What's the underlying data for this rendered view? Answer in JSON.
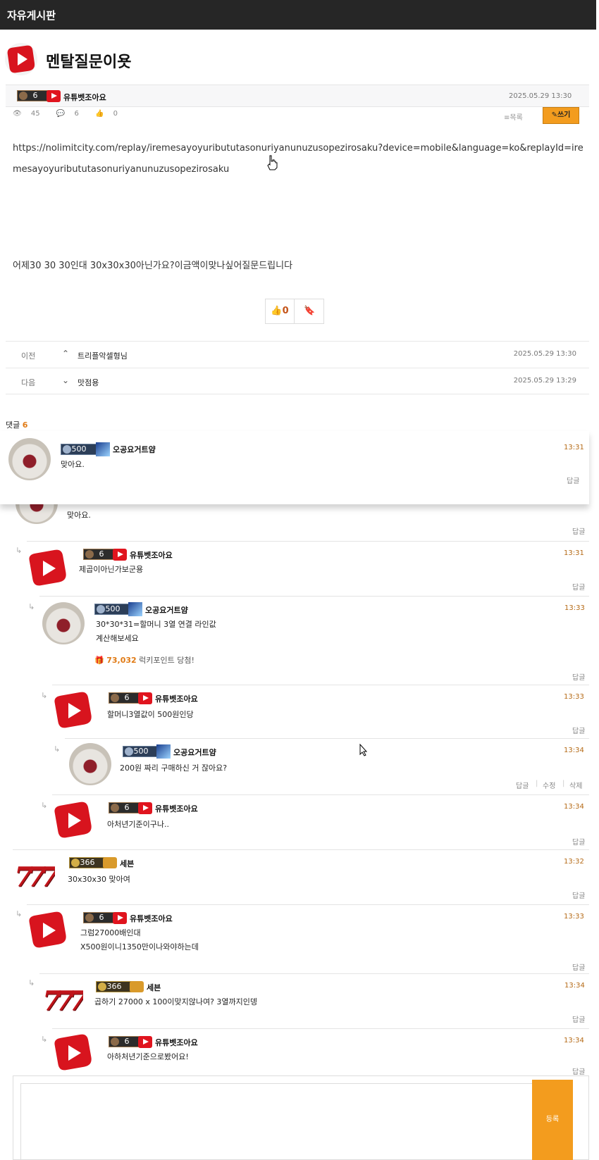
{
  "header": {
    "title": "자유게시판"
  },
  "post": {
    "title": "멘탈질문이욧",
    "author": {
      "level": "6",
      "nickname": "유튜벳조아요"
    },
    "datetime": "2025.05.29 13:30",
    "views": "45",
    "comments": "6",
    "likes": "0",
    "list_label": "목록",
    "write_label": "쓰기",
    "url": "https://nolimitcity.com/replay/iremesayoyuribututasonuriyanunuzusopezirosaku?device=mobile&language=ko&replayId=iremesayoyuribututasonuriyanunuzusopezirosaku",
    "body": "어제30 30 30인대 30x30x30아닌가요?이금액이맞나싶어질문드립니다",
    "like_count": "0"
  },
  "nav": {
    "prev": {
      "label": "이전",
      "title": "트리플악셀형님",
      "date": "2025.05.29 13:30"
    },
    "next": {
      "label": "다음",
      "title": "맛점용",
      "date": "2025.05.29 13:29"
    }
  },
  "comments_header": {
    "label": "댓글",
    "count": "6"
  },
  "comments": [
    {
      "level": "500",
      "nickname": "오공요거트얌",
      "time": "13:31",
      "text": "맞아요.",
      "reply": "답글"
    },
    {
      "level": "6",
      "nickname": "유튜벳조아요",
      "time": "13:31",
      "text": "제곱이아닌가보군용",
      "reply": "답글"
    },
    {
      "level": "500",
      "nickname": "오공요거트얌",
      "time": "13:33",
      "text_1": "30*30*31=할머니 3열 연결 라인값",
      "text_2": "계산해보세요",
      "lucky_points": "73,032",
      "lucky_label": "럭키포인트 당첨!",
      "reply": "답글"
    },
    {
      "level": "6",
      "nickname": "유튜벳조아요",
      "time": "13:33",
      "text": "할머니3열값이 500원인당",
      "reply": "답글"
    },
    {
      "level": "500",
      "nickname": "오공요거트얌",
      "time": "13:34",
      "text": "200원 짜리 구매하신 거 잖아요?",
      "reply": "답글",
      "edit": "수정",
      "delete": "삭제"
    },
    {
      "level": "6",
      "nickname": "유튜벳조아요",
      "time": "13:34",
      "text": "아처년기준이구나..",
      "reply": "답글"
    },
    {
      "level": "366",
      "nickname": "세븐",
      "time": "13:32",
      "text": "30x30x30 맞아여",
      "reply": "답글"
    },
    {
      "level": "6",
      "nickname": "유튜벳조아요",
      "time": "13:33",
      "text_1": "그럼27000배인대",
      "text_2": "X500원이니1350만이나와야하는데",
      "reply": "답글"
    },
    {
      "level": "366",
      "nickname": "세븐",
      "time": "13:34",
      "text": "곱하기 27000 x 100이맞지않나여? 3열까지인뎅",
      "reply": "답글"
    },
    {
      "level": "6",
      "nickname": "유튜벳조아요",
      "time": "13:34",
      "text": "아하처년기준으로봤어요!",
      "reply": "답글"
    }
  ],
  "sticky_preview": {
    "level": "500",
    "nickname": "오공요거트얌",
    "time": "13:31",
    "text": "맞아요.",
    "reply": "답글",
    "under_text": "맞아요.",
    "under_reply": "답글"
  },
  "editor": {
    "submit_label": "등록"
  },
  "icons": {
    "eye": "eye-icon",
    "comment": "comment-icon",
    "thumb": "thumbs-up-icon",
    "bookmark": "bookmark-icon",
    "list": "list-icon",
    "pencil": "pencil-icon",
    "gift": "gift-icon"
  },
  "colors": {
    "accent": "#f39c1e",
    "topbar": "#262626",
    "youtube_red": "#e0141e"
  }
}
